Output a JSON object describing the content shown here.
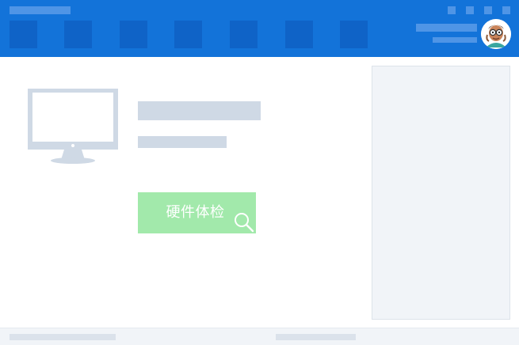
{
  "header": {
    "nav_tiles": [
      "nav-1",
      "nav-2",
      "nav-3",
      "nav-4",
      "nav-5",
      "nav-6",
      "nav-7"
    ],
    "window_controls": [
      "menu-icon",
      "skin-icon",
      "minimize-icon",
      "close-icon"
    ],
    "avatar_icon": "avatar-icon"
  },
  "main": {
    "hardware_check_button": {
      "label": "硬件体检",
      "icon": "search-icon"
    },
    "monitor_icon": "monitor-icon"
  },
  "colors": {
    "header_bg": "#1373d9",
    "nav_tile": "#0f63c7",
    "skeleton_light": "#4f95e6",
    "skeleton_gray": "#cfd9e5",
    "button_green": "#a2e9ab",
    "panel_bg": "#f1f4f8"
  }
}
